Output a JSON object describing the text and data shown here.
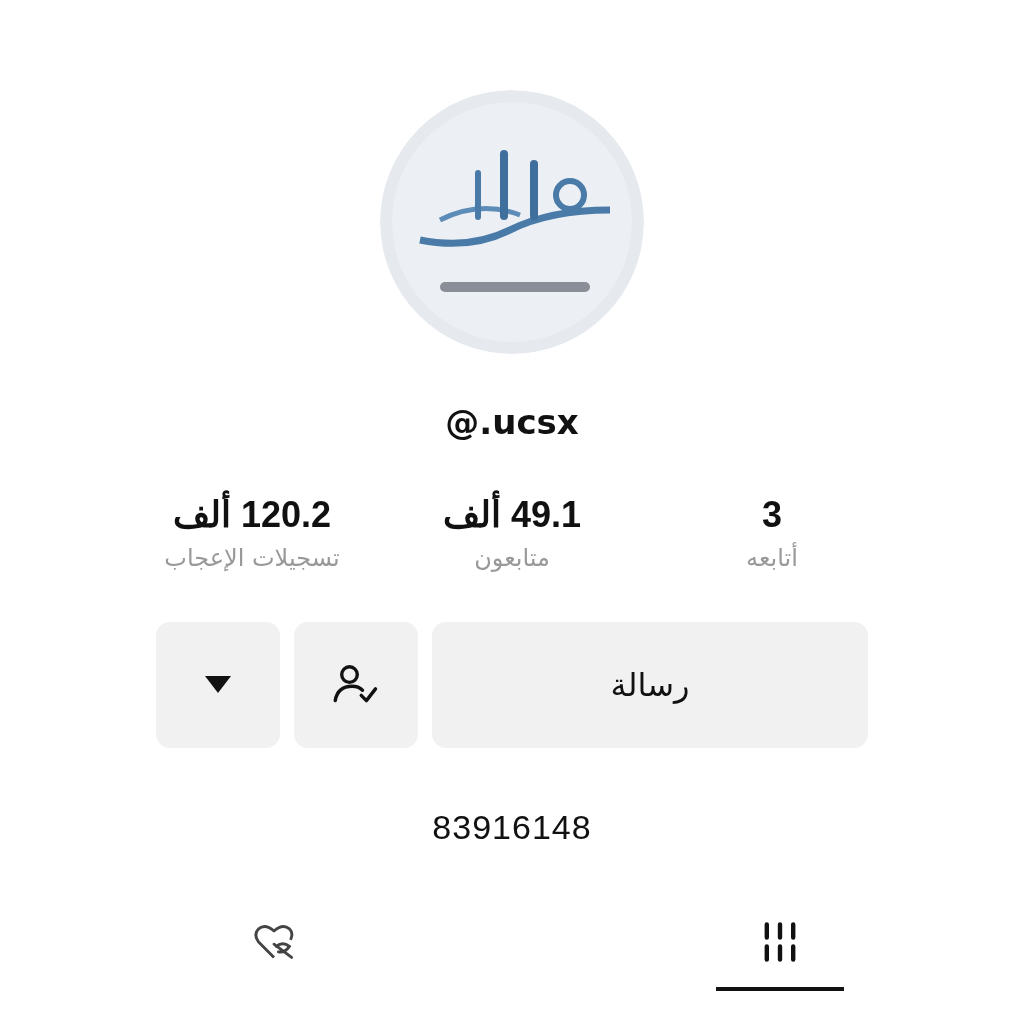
{
  "profile": {
    "username": "@.ucsx"
  },
  "stats": [
    {
      "value": "3",
      "label": "أتابعه"
    },
    {
      "value": "49.1 ألف",
      "label": "متابعون"
    },
    {
      "value": "120.2 ألف",
      "label": "تسجيلات الإعجاب"
    }
  ],
  "actions": {
    "message": "رسالة"
  },
  "bio": "83916148",
  "tabs": [
    {
      "kind": "videos",
      "selected": true
    },
    {
      "kind": "liked",
      "selected": false
    }
  ]
}
